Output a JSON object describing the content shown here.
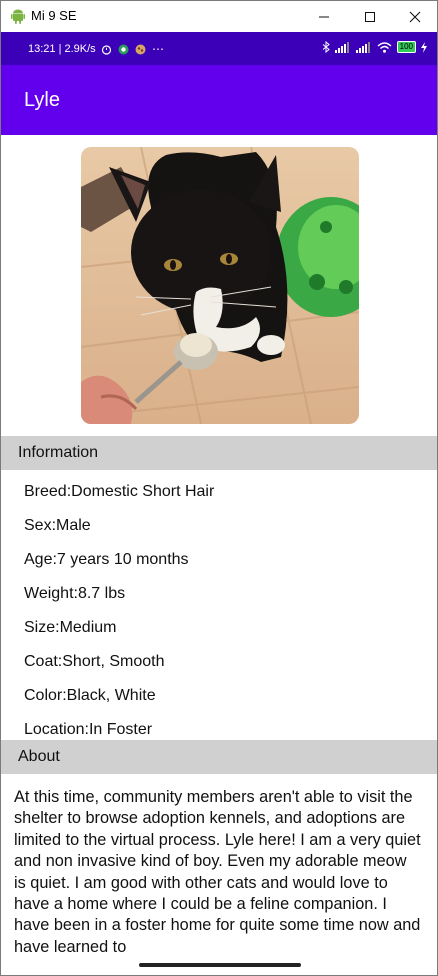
{
  "window": {
    "title": "Mi 9 SE"
  },
  "statusbar": {
    "time_speed": "13:21 | 2.9K/s",
    "battery": "100",
    "more": "⋯"
  },
  "appbar": {
    "title": "Lyle"
  },
  "information": {
    "header": "Information",
    "rows": [
      "Breed:Domestic Short Hair",
      "Sex:Male",
      "Age:7 years 10 months",
      "Weight:8.7 lbs",
      "Size:Medium",
      "Coat:Short, Smooth",
      "Color:Black, White",
      "Location:In Foster"
    ]
  },
  "about": {
    "header": "About",
    "text": "At this time, community members aren't able to visit the shelter to browse adoption kennels, and adoptions are limited to the virtual process. Lyle here! I am a very quiet and non invasive kind of boy. Even my adorable meow is quiet. I am good with other cats and would love to have a home where I could be a feline companion. I have been in a foster home for quite some time now and have learned to"
  },
  "colors": {
    "status_bar": "#3b00b8",
    "app_bar": "#6200ee",
    "section_header": "#d0d0d0"
  },
  "icons": [
    "android-icon",
    "minimize-icon",
    "maximize-icon",
    "close-icon",
    "alarm-icon",
    "bluetooth-icon",
    "signal-icon",
    "wifi-icon",
    "battery-icon",
    "charging-icon"
  ]
}
